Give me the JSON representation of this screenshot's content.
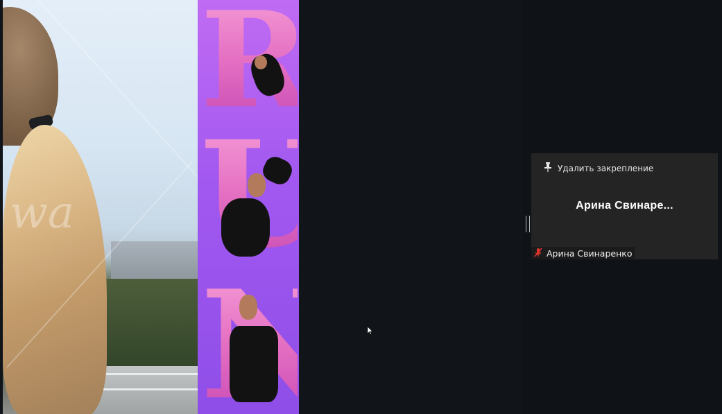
{
  "participant": {
    "unpin_label": "Удалить закрепление",
    "display_name_truncated": "Арина  Свинаре...",
    "name_label": "Арина Свинаренко"
  },
  "poster": {
    "letters": [
      "R",
      "U",
      "N"
    ]
  },
  "icons": {
    "pin": "pin-icon",
    "mic": "mic-muted-icon",
    "cursor": "mouse-cursor-icon"
  },
  "colors": {
    "tile_bg": "#242424",
    "muted_red": "#e0362b",
    "poster_purple": "#a158f0"
  }
}
